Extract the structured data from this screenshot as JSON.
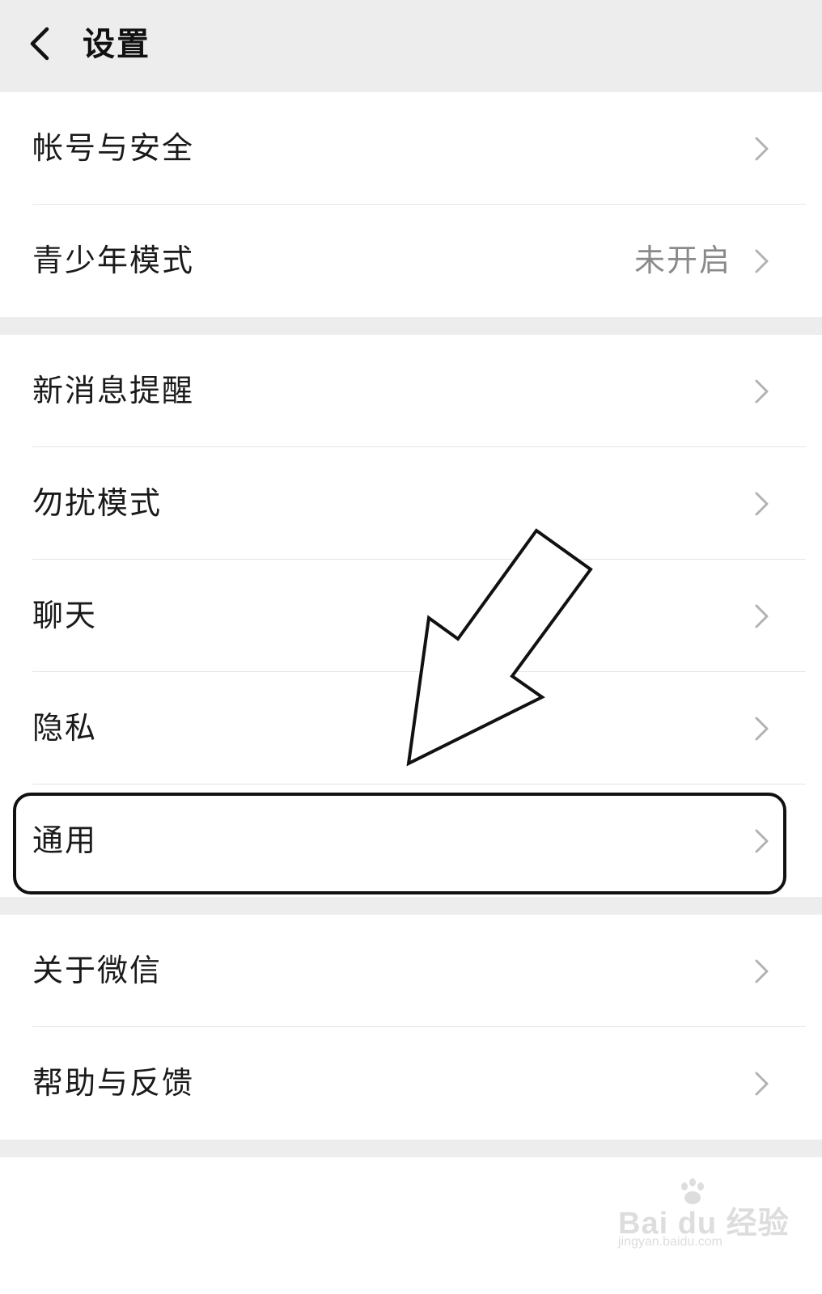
{
  "header": {
    "title": "设置"
  },
  "menu": {
    "section1": [
      {
        "label": "帐号与安全",
        "value": ""
      },
      {
        "label": "青少年模式",
        "value": "未开启"
      }
    ],
    "section2": [
      {
        "label": "新消息提醒",
        "value": ""
      },
      {
        "label": "勿扰模式",
        "value": ""
      },
      {
        "label": "聊天",
        "value": ""
      },
      {
        "label": "隐私",
        "value": ""
      },
      {
        "label": "通用",
        "value": ""
      }
    ],
    "section3": [
      {
        "label": "关于微信",
        "value": ""
      },
      {
        "label": "帮助与反馈",
        "value": ""
      }
    ]
  },
  "watermark": {
    "brand": "Bai du 经验",
    "url": "jingyan.baidu.com"
  },
  "icons": {
    "back": "chevron-left-icon",
    "row": "chevron-right-icon"
  },
  "colors": {
    "background": "#ededed",
    "row_bg": "#ffffff",
    "text": "#1a1a1a",
    "secondary_text": "#8a8a8a",
    "chevron": "#b2b2b2",
    "highlight": "#111111"
  }
}
